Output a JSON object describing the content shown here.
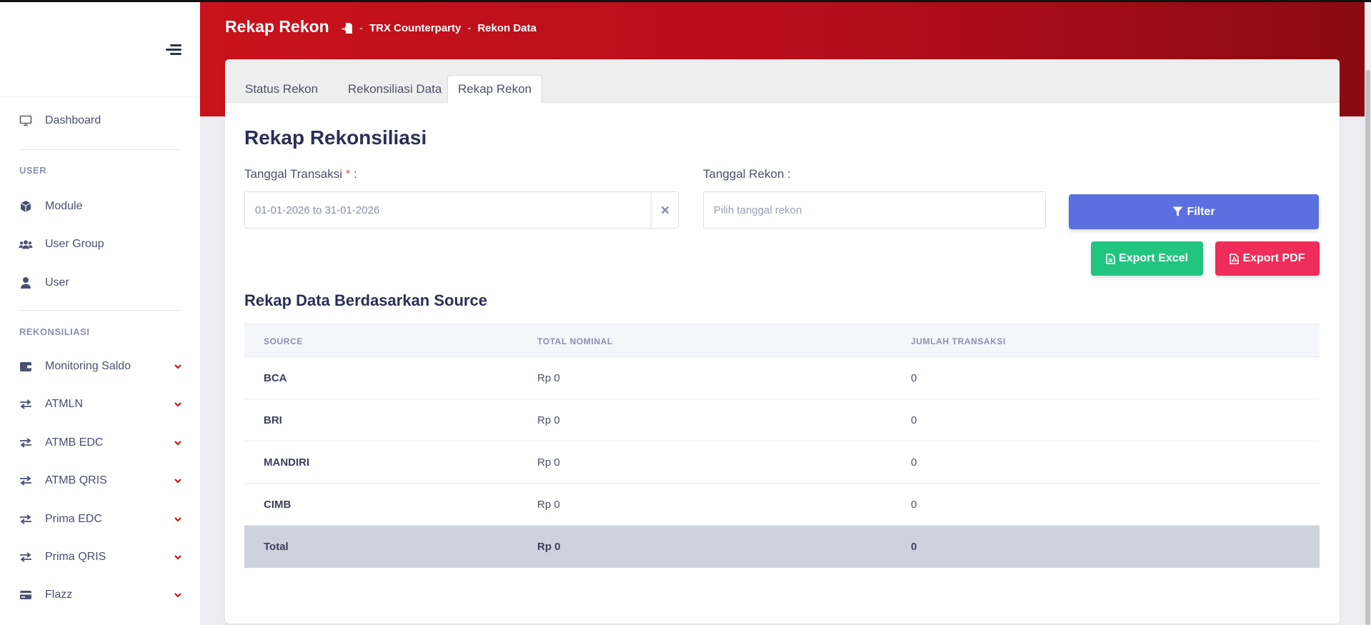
{
  "header": {
    "title": "Rekap Rekon",
    "breadcrumb": [
      "TRX Counterparty",
      "Rekon Data"
    ]
  },
  "sidebar": {
    "items": [
      {
        "label": "Dashboard",
        "icon": "monitor-icon"
      },
      {
        "label": "Module",
        "icon": "cube-icon"
      },
      {
        "label": "User Group",
        "icon": "users-icon"
      },
      {
        "label": "User",
        "icon": "user-icon"
      },
      {
        "label": "Monitoring Saldo",
        "icon": "wallet-icon"
      },
      {
        "label": "ATMLN",
        "icon": "exchange-icon"
      },
      {
        "label": "ATMB EDC",
        "icon": "exchange-icon"
      },
      {
        "label": "ATMB QRIS",
        "icon": "exchange-icon"
      },
      {
        "label": "Prima EDC",
        "icon": "exchange-icon"
      },
      {
        "label": "Prima QRIS",
        "icon": "exchange-icon"
      },
      {
        "label": "Flazz",
        "icon": "card-icon"
      }
    ],
    "sections": [
      "USER",
      "REKONSILIASI"
    ]
  },
  "tabs": [
    "Status Rekon",
    "Rekonsiliasi Data",
    "Rekap Rekon"
  ],
  "active_tab": "Rekap Rekon",
  "form": {
    "title": "Rekap Rekonsiliasi",
    "tanggal_transaksi_label": "Tanggal Transaksi",
    "required_mark": "*",
    "label_suffix": ":",
    "tanggal_transaksi_value": "01-01-2026 to 31-01-2026",
    "tanggal_rekon_label": "Tanggal Rekon :",
    "tanggal_rekon_placeholder": "Pilih tanggal rekon",
    "filter_label": "Filter",
    "export_excel_label": "Export Excel",
    "export_pdf_label": "Export PDF"
  },
  "table": {
    "title": "Rekap Data Berdasarkan Source",
    "columns": [
      "SOURCE",
      "TOTAL NOMINAL",
      "JUMLAH TRANSAKSI"
    ],
    "rows": [
      {
        "source": "BCA",
        "nominal": "Rp 0",
        "jumlah": "0"
      },
      {
        "source": "BRI",
        "nominal": "Rp 0",
        "jumlah": "0"
      },
      {
        "source": "MANDIRI",
        "nominal": "Rp 0",
        "jumlah": "0"
      },
      {
        "source": "CIMB",
        "nominal": "Rp 0",
        "jumlah": "0"
      }
    ],
    "total": {
      "label": "Total",
      "nominal": "Rp 0",
      "jumlah": "0"
    }
  },
  "colors": {
    "header_red": "#c8121c",
    "filter_blue": "#5c6fe0",
    "excel_green": "#21c57f",
    "pdf_red": "#ee2d5a",
    "chevron_red": "#c8121c"
  }
}
